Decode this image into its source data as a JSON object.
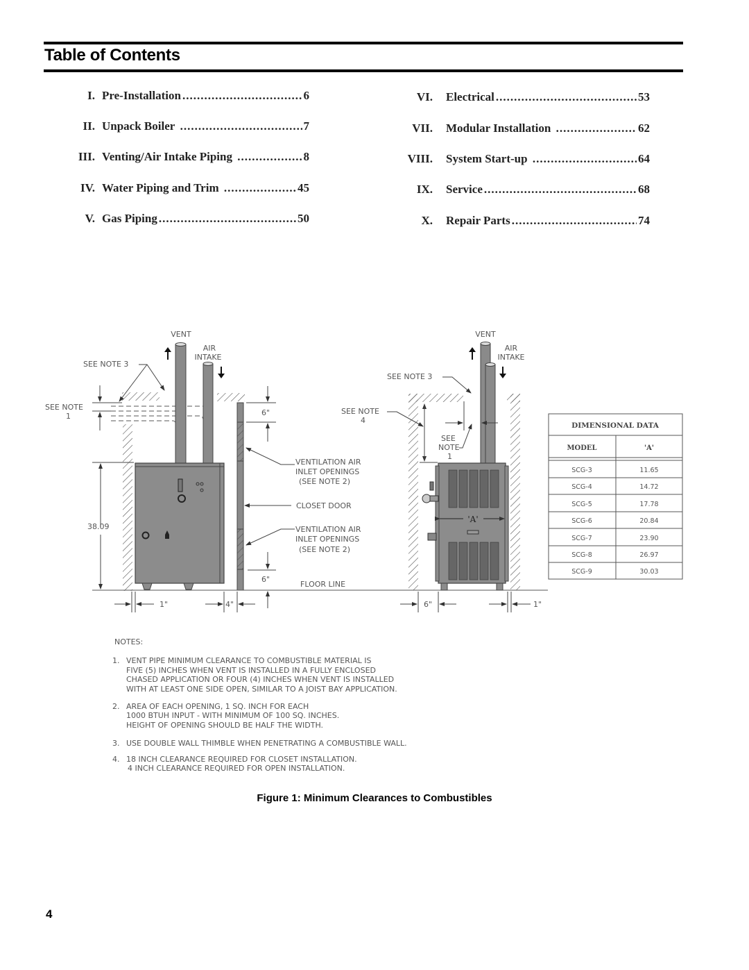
{
  "page": {
    "title": "Table of Contents",
    "page_number": "4"
  },
  "toc": {
    "left": [
      {
        "num": "I.",
        "label": "Pre-Installation",
        "page": "6"
      },
      {
        "num": "II.",
        "label": "Unpack Boiler",
        "page": "7"
      },
      {
        "num": "III.",
        "label": "Venting/Air Intake Piping",
        "page": "8"
      },
      {
        "num": "IV.",
        "label": "Water Piping and Trim",
        "page": "45"
      },
      {
        "num": "V.",
        "label": "Gas Piping",
        "page": "50"
      }
    ],
    "right": [
      {
        "num": "VI.",
        "label": "Electrical",
        "page": "53"
      },
      {
        "num": "VII.",
        "label": "Modular Installation",
        "page": "62"
      },
      {
        "num": "VIII.",
        "label": "System Start-up",
        "page": "64"
      },
      {
        "num": "IX.",
        "label": "Service",
        "page": "68"
      },
      {
        "num": "X.",
        "label": "Repair Parts",
        "page": "74"
      }
    ]
  },
  "figure": {
    "caption": "Figure 1:  Minimum Clearances to Combustibles",
    "left_view": {
      "vent": "VENT",
      "air_intake_1": "AIR",
      "air_intake_2": "INTAKE",
      "see_note_3": "SEE NOTE 3",
      "see_note_1a": "SEE NOTE",
      "see_note_1b": "1",
      "dim_top": "6\"",
      "vent_air_1a": "VENTILATION AIR",
      "vent_air_1b": "INLET OPENINGS",
      "vent_air_1c": "(SEE NOTE 2)",
      "closet_door": "CLOSET DOOR",
      "vent_air_2a": "VENTILATION AIR",
      "vent_air_2b": "INLET OPENINGS",
      "vent_air_2c": "(SEE NOTE 2)",
      "height": "38.09",
      "dim_bottom": "6\"",
      "floor_line": "FLOOR LINE",
      "dim_side": "1\"",
      "dim_front": "4\""
    },
    "right_view": {
      "vent": "VENT",
      "air_intake_1": "AIR",
      "air_intake_2": "INTAKE",
      "see_note_3": "SEE NOTE 3",
      "see_note_4a": "SEE NOTE",
      "see_note_4b": "4",
      "see_note_1a": "SEE",
      "see_note_1b": "NOTE",
      "see_note_1c": "1",
      "dim_a": "'A'",
      "dim_left": "6\"",
      "dim_right": "1\""
    },
    "dimensional_table": {
      "title": "DIMENSIONAL DATA",
      "headers": [
        "MODEL",
        "'A'"
      ],
      "rows": [
        [
          "SCG-3",
          "11.65"
        ],
        [
          "SCG-4",
          "14.72"
        ],
        [
          "SCG-5",
          "17.78"
        ],
        [
          "SCG-6",
          "20.84"
        ],
        [
          "SCG-7",
          "23.90"
        ],
        [
          "SCG-8",
          "26.97"
        ],
        [
          "SCG-9",
          "30.03"
        ]
      ]
    },
    "notes": {
      "heading": "NOTES:",
      "items": [
        {
          "num": "1.",
          "lines": [
            "VENT PIPE MINIMUM CLEARANCE TO COMBUSTIBLE MATERIAL IS",
            "FIVE (5) INCHES WHEN VENT IS INSTALLED IN A FULLY ENCLOSED",
            "CHASED APPLICATION OR FOUR (4) INCHES WHEN VENT IS INSTALLED",
            "WITH AT LEAST ONE SIDE OPEN, SIMILAR TO A JOIST BAY APPLICATION."
          ]
        },
        {
          "num": "2.",
          "lines": [
            "AREA OF EACH OPENING, 1 SQ. INCH FOR EACH",
            "1000 BTUH INPUT - WITH MINIMUM OF 100 SQ. INCHES.",
            "HEIGHT OF OPENING SHOULD BE HALF THE WIDTH."
          ]
        },
        {
          "num": "3.",
          "lines": [
            "USE DOUBLE WALL THIMBLE WHEN PENETRATING A COMBUSTIBLE WALL."
          ]
        },
        {
          "num": "4.",
          "lines": [
            "18 INCH CLEARANCE REQUIRED FOR CLOSET INSTALLATION.",
            "4 INCH CLEARANCE REQUIRED FOR OPEN INSTALLATION."
          ]
        }
      ]
    }
  }
}
